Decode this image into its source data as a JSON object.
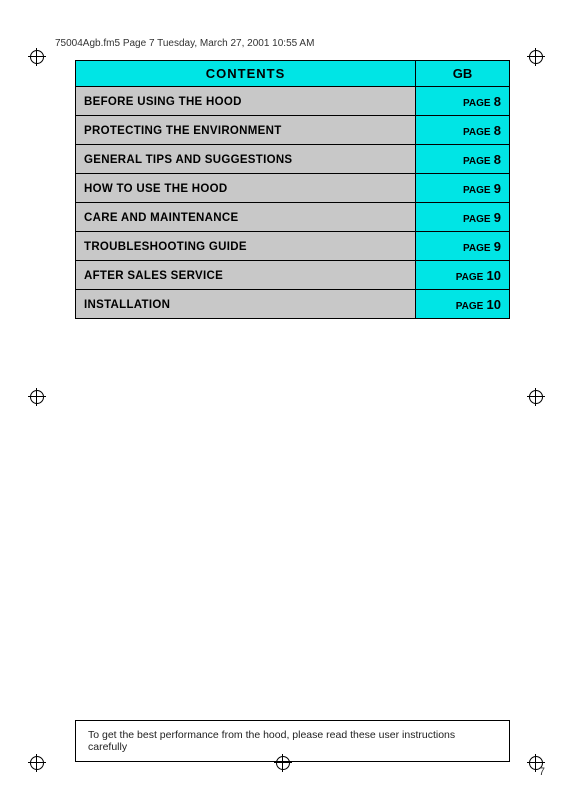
{
  "header": {
    "file_info": "75004Agb.fm5  Page 7  Tuesday, March 27, 2001  10:55 AM"
  },
  "contents": {
    "title": "CONTENTS",
    "gb_label": "GB",
    "rows": [
      {
        "label": "BEFORE USING THE HOOD",
        "page_text": "PAGE",
        "page_num": "8"
      },
      {
        "label": "PROTECTING THE ENVIRONMENT",
        "page_text": "PAGE",
        "page_num": "8"
      },
      {
        "label": "GENERAL TIPS AND SUGGESTIONS",
        "page_text": "PAGE",
        "page_num": "8"
      },
      {
        "label": "HOW TO USE THE HOOD",
        "page_text": "PAGE",
        "page_num": "9"
      },
      {
        "label": "CARE AND MAINTENANCE",
        "page_text": "PAGE",
        "page_num": "9"
      },
      {
        "label": "TROUBLESHOOTING GUIDE",
        "page_text": "PAGE",
        "page_num": "9"
      },
      {
        "label": "AFTER SALES SERVICE",
        "page_text": "PAGE",
        "page_num": "10"
      },
      {
        "label": "INSTALLATION",
        "page_text": "PAGE",
        "page_num": "10"
      }
    ]
  },
  "footer": {
    "note": "To get the best performance from the hood, please read these user instructions carefully"
  },
  "page_number": "7"
}
